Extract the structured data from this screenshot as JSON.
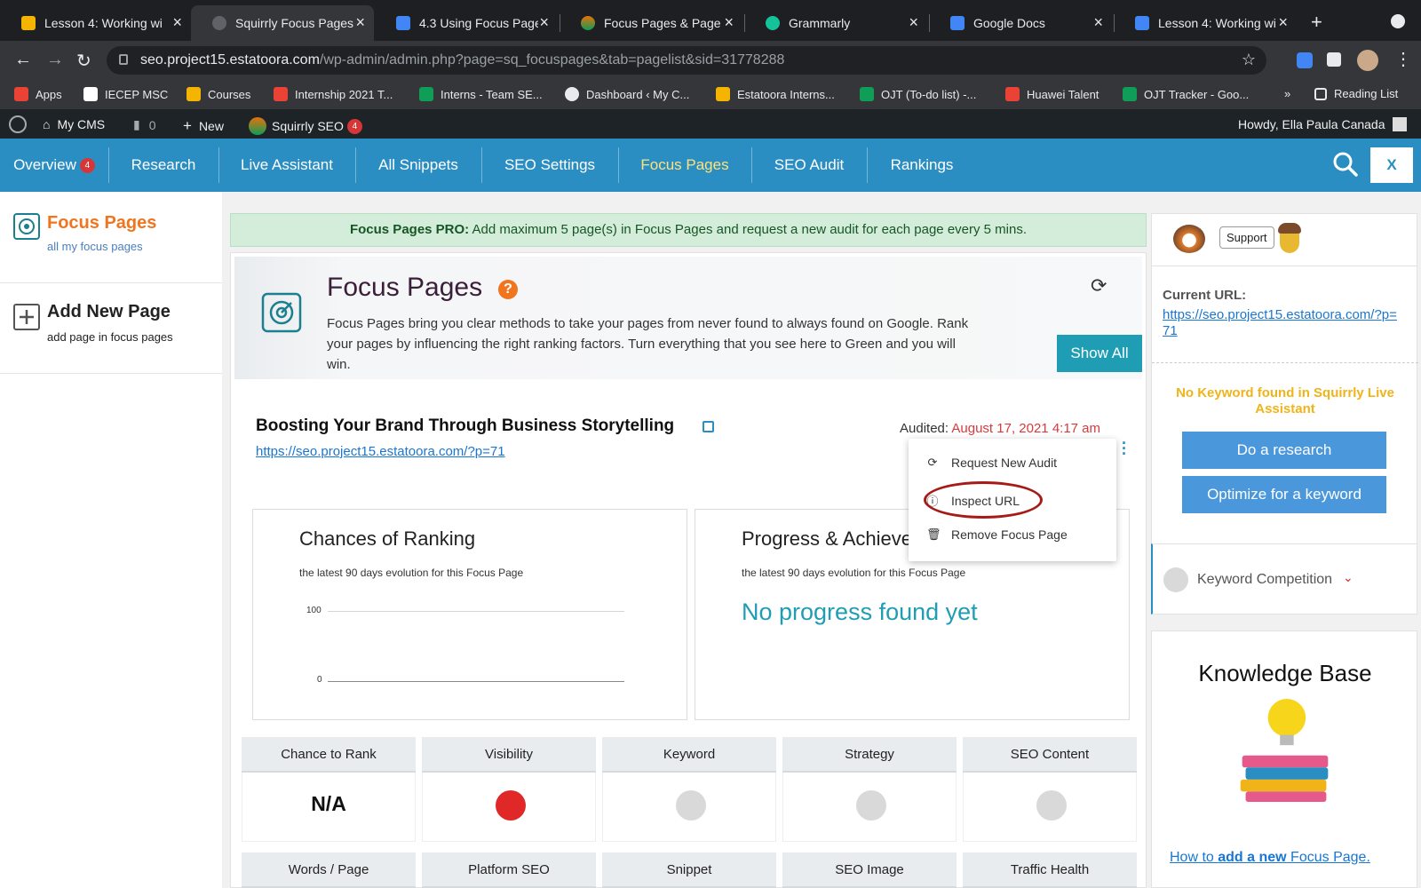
{
  "browser": {
    "tabs": [
      {
        "label": "Lesson 4: Working wi",
        "icon_color": "#f4b400"
      },
      {
        "label": "Squirrly Focus Pages",
        "icon_color": "#5f6368"
      },
      {
        "label": "4.3 Using Focus Page",
        "icon_color": "#4285f4"
      },
      {
        "label": "Focus Pages & Page A",
        "icon_color": "#e8710a"
      },
      {
        "label": "Grammarly",
        "icon_color": "#15c39a"
      },
      {
        "label": "Google Docs",
        "icon_color": "#4285f4"
      },
      {
        "label": "Lesson 4: Working wi",
        "icon_color": "#4285f4"
      }
    ],
    "url_domain": "seo.project15.estatoora.com",
    "url_path": "/wp-admin/admin.php?page=sq_focuspages&tab=pagelist&sid=31778288",
    "bookmarks": [
      {
        "label": "Apps",
        "color": "#ea4335"
      },
      {
        "label": "IECEP MSC",
        "color": "#ffffff"
      },
      {
        "label": "Courses",
        "color": "#f4b400"
      },
      {
        "label": "Internship 2021 T...",
        "color": "#ea4335"
      },
      {
        "label": "Interns - Team SE...",
        "color": "#0f9d58"
      },
      {
        "label": "Dashboard ‹ My C...",
        "color": "#e8eaed"
      },
      {
        "label": "Estatoora Interns...",
        "color": "#f4b400"
      },
      {
        "label": "OJT (To-do list) -...",
        "color": "#0f9d58"
      },
      {
        "label": "Huawei Talent",
        "color": "#ea4335"
      },
      {
        "label": "OJT Tracker - Goo...",
        "color": "#0f9d58"
      }
    ],
    "more": "»",
    "reading_list": "Reading List"
  },
  "wpbar": {
    "site": "My CMS",
    "comments": "0",
    "new": "New",
    "plugin": "Squirrly SEO",
    "plugin_badge": "4",
    "howdy": "Howdy, Ella Paula Canada"
  },
  "sqnav": {
    "items": [
      "Overview",
      "Research",
      "Live Assistant",
      "All Snippets",
      "SEO Settings",
      "Focus Pages",
      "SEO Audit",
      "Rankings"
    ],
    "overview_badge": "4",
    "close": "X"
  },
  "leftnav": {
    "focus_title": "Focus Pages",
    "focus_sub": "all my focus pages",
    "add_title": "Add New Page",
    "add_sub": "add page in focus pages"
  },
  "banner": {
    "strong": "Focus Pages PRO:",
    "text": " Add maximum 5 page(s) in Focus Pages and request a new audit for each page every 5 mins."
  },
  "hero": {
    "title": "Focus Pages",
    "help": "?",
    "desc": "Focus Pages bring you clear methods to take your pages from never found to always found on Google. Rank your pages by influencing the right ranking factors. Turn everything that you see here to Green and you will win.",
    "show_all": "Show All"
  },
  "page": {
    "title": "Boosting Your Brand Through Business Storytelling",
    "url": "https://seo.project15.estatoora.com/?p=71",
    "audited_label": "Audited: ",
    "audited_date": "August 17, 2021 4:17 am"
  },
  "context_menu": {
    "items": [
      "Request New Audit",
      "Inspect URL",
      "Remove Focus Page"
    ]
  },
  "chance_chart": {
    "title": "Chances of Ranking",
    "subtitle": "the latest 90 days evolution for this Focus Page",
    "y_top": "100",
    "y_bottom": "0"
  },
  "chart_data": {
    "type": "line",
    "title": "Chances of Ranking",
    "subtitle": "the latest 90 days evolution for this Focus Page",
    "ylim": [
      0,
      100
    ],
    "y_ticks": [
      "100",
      "0"
    ],
    "series": []
  },
  "progress": {
    "title": "Progress & Achieve",
    "subtitle": "the latest 90 days evolution for this Focus Page",
    "empty": "No progress found yet"
  },
  "metrics_row1": [
    {
      "label": "Chance to Rank",
      "value": "N/A",
      "status": null
    },
    {
      "label": "Visibility",
      "status": "#e02828"
    },
    {
      "label": "Keyword",
      "status": "#d9d9d9"
    },
    {
      "label": "Strategy",
      "status": "#d9d9d9"
    },
    {
      "label": "SEO Content",
      "status": "#d9d9d9"
    }
  ],
  "metrics_row2": [
    "Words / Page",
    "Platform SEO",
    "Snippet",
    "SEO Image",
    "Traffic Health"
  ],
  "rightpanel": {
    "support": "Support",
    "current_url_label": "Current URL:",
    "current_url": "https://seo.project15.estatoora.com/?p=71",
    "no_keyword": "No Keyword found in Squirrly Live Assistant",
    "do_research": "Do a research",
    "optimize": "Optimize for a keyword",
    "keyword_competition": "Keyword Competition",
    "kb_title": "Knowledge Base",
    "kb_link_pre": "How to ",
    "kb_link_bold": "add a new",
    "kb_link_post": " Focus Page."
  }
}
